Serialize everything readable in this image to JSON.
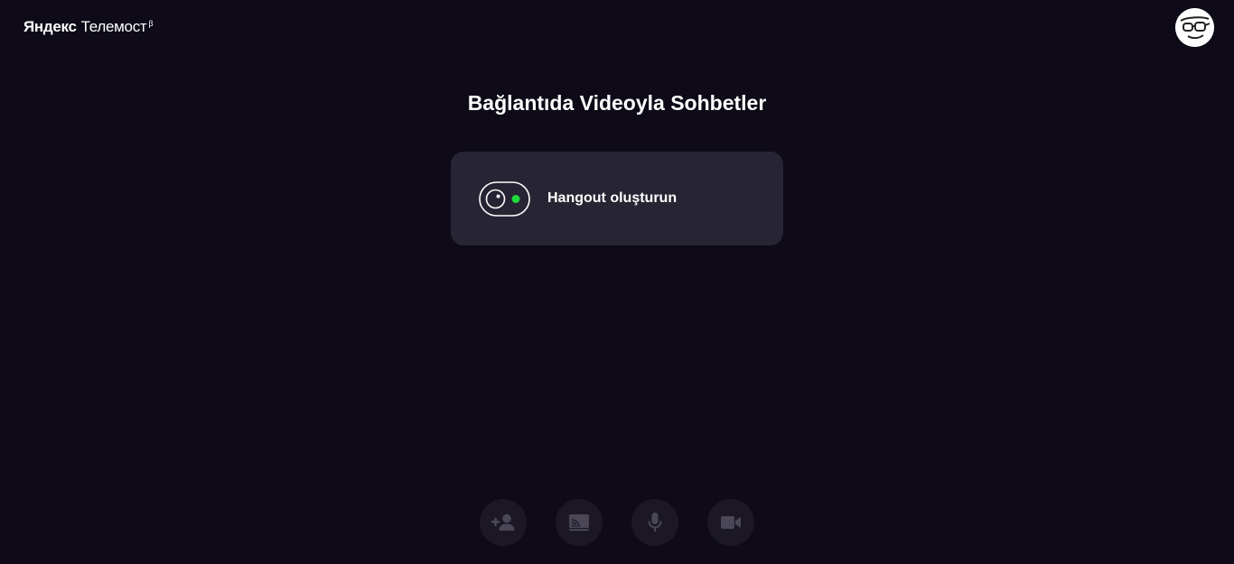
{
  "header": {
    "logo_brand": "Яндекс",
    "logo_product": "Телемост",
    "logo_badge": "β",
    "avatar_icon": "user-avatar-glasses-icon"
  },
  "main": {
    "title": "Bağlantıda Videoyla Sohbetler",
    "create_card": {
      "label": "Hangout oluşturun",
      "icon": "camera-toggle-icon",
      "indicator_color": "#1fdb3a"
    }
  },
  "controls": [
    {
      "name": "add-participant",
      "icon": "add-person-icon"
    },
    {
      "name": "screen-share",
      "icon": "cast-screen-icon"
    },
    {
      "name": "microphone",
      "icon": "microphone-icon"
    },
    {
      "name": "camera",
      "icon": "video-camera-icon"
    }
  ],
  "colors": {
    "background": "#0e0a17",
    "card": "#272433",
    "control_bg": "#1b1824",
    "control_icon": "#4a4656",
    "accent_green": "#1fdb3a"
  }
}
